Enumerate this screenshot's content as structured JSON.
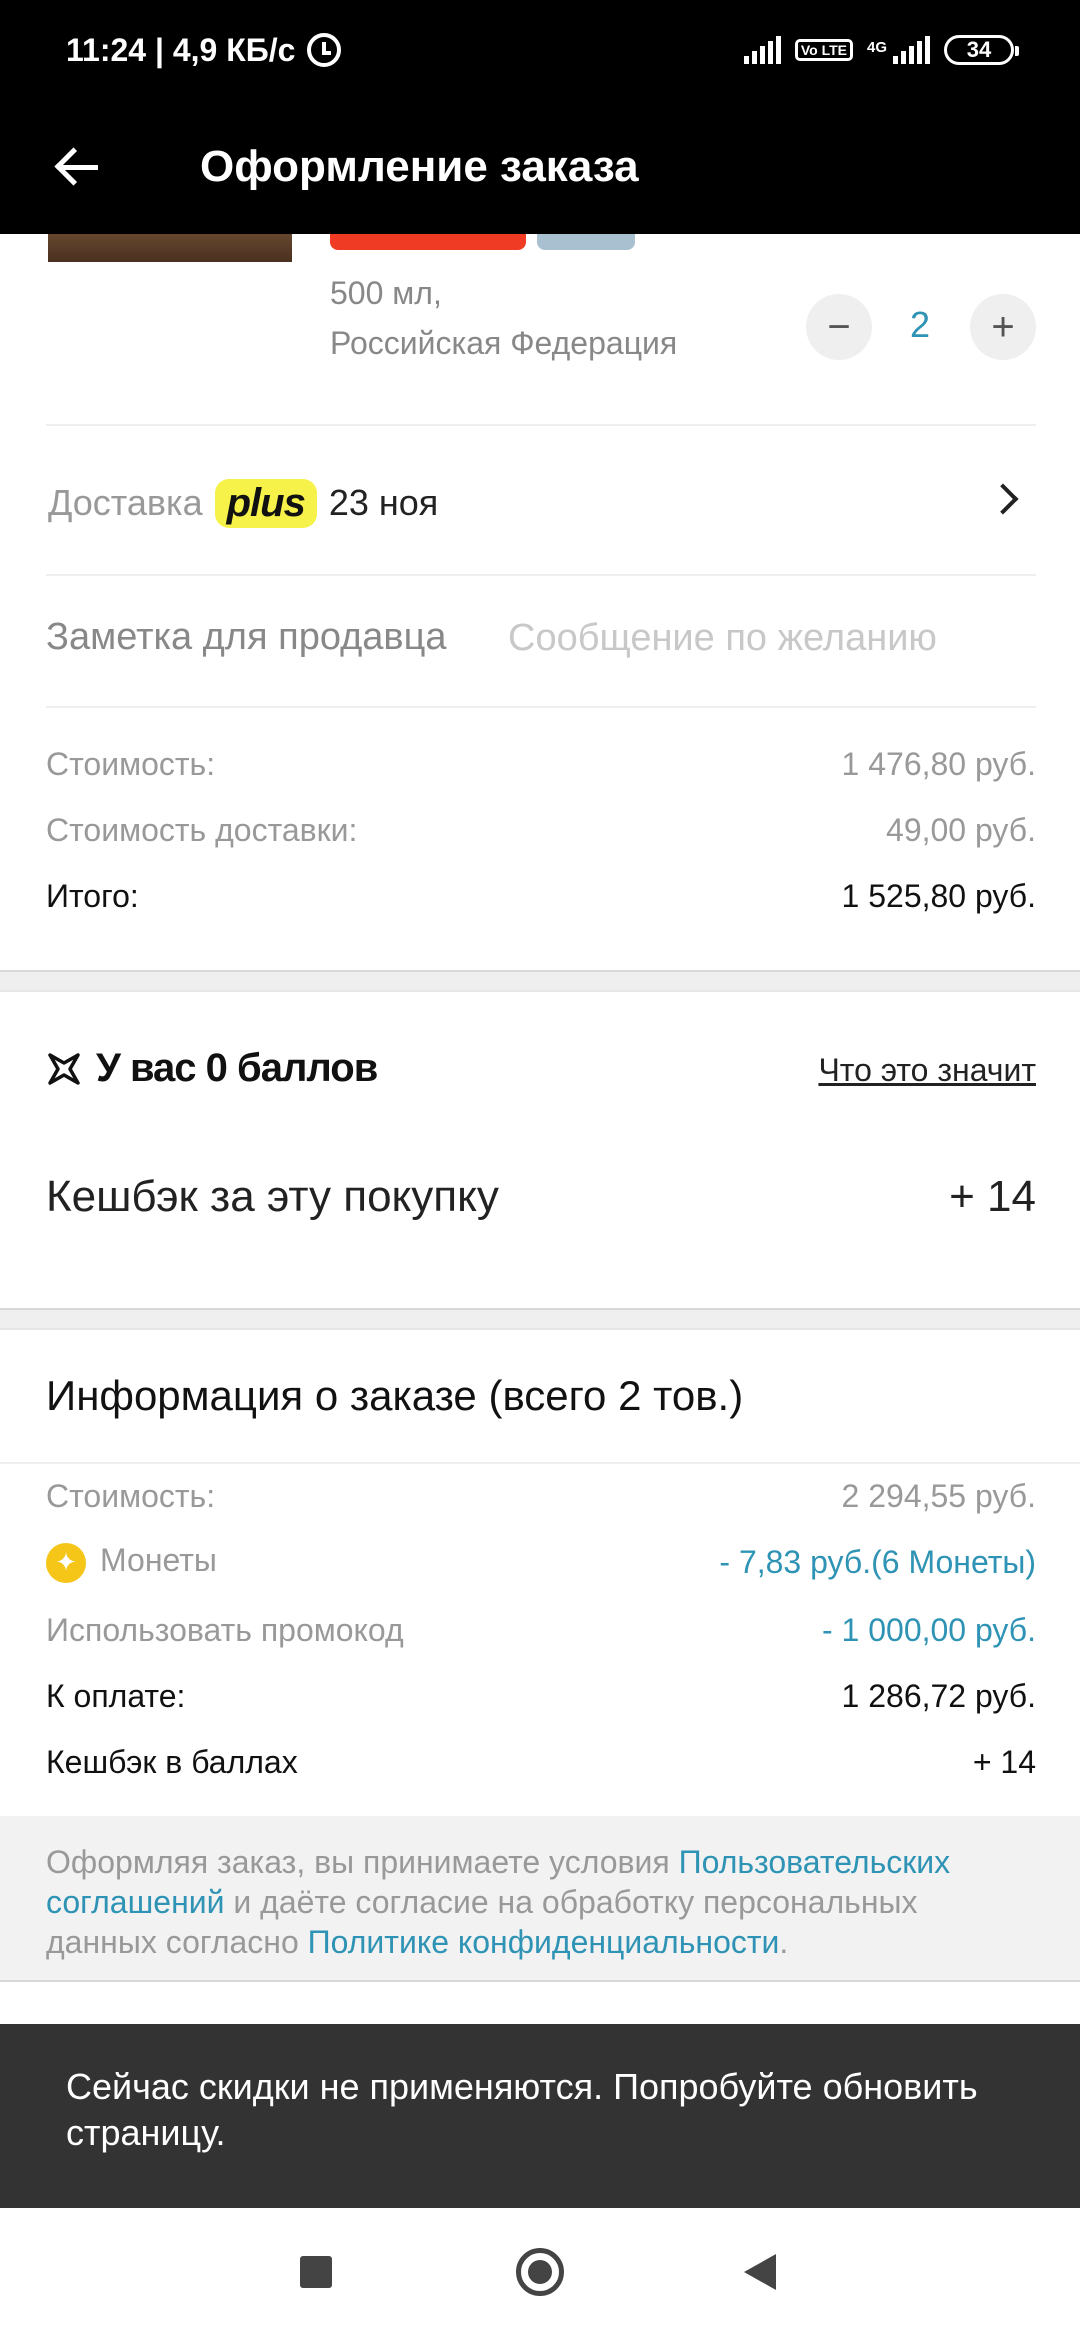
{
  "status_bar": {
    "time_speed": "11:24 | 4,9 КБ/с",
    "volte": "Vo LTE",
    "net": "4G",
    "battery": "34"
  },
  "header": {
    "title": "Оформление заказа"
  },
  "product": {
    "volume": "500 мл,",
    "origin": "Российская Федерация",
    "quantity": "2",
    "minus": "−",
    "plus": "+"
  },
  "delivery": {
    "label": "Доставка",
    "badge": "plus",
    "date": "23 ноя"
  },
  "seller_note": {
    "label": "Заметка для продавца",
    "placeholder": "Сообщение по желанию"
  },
  "summary": {
    "cost_label": "Стоимость:",
    "cost_value": "1 476,80 руб.",
    "shipping_label": "Стоимость доставки:",
    "shipping_value": "49,00 руб.",
    "total_label": "Итого:",
    "total_value": "1 525,80 руб."
  },
  "points": {
    "title": "У вас 0 баллов",
    "link": "Что это значит",
    "cashback_label": "Кешбэк за эту покупку",
    "cashback_value": "+ 14"
  },
  "order_info": {
    "title": "Информация о заказе (всего 2 тов.)",
    "cost_label": "Стоимость:",
    "cost_value": "2 294,55 руб.",
    "coins_label": "Монеты",
    "coins_value": "- 7,83 руб.(6 Монеты)",
    "promo_label": "Использовать промокод",
    "promo_value": "- 1 000,00 руб.",
    "pay_label": "К оплате:",
    "pay_value": "1 286,72 руб.",
    "cashback_label": "Кешбэк в баллах",
    "cashback_value": "+ 14"
  },
  "terms": {
    "part1": "Оформляя заказ, вы принимаете условия ",
    "link1": "Пользовательских соглашений",
    "part2": " и даёте согласие на обработку персональных данных согласно ",
    "link2": "Политике конфиденциальности",
    "part3": "."
  },
  "toast": {
    "message": "Сейчас скидки не применяются. Попробуйте обновить страницу."
  },
  "colors": {
    "accent_blue": "#2e93b4",
    "plus_yellow": "#f6f24a",
    "tag_red": "#ef3b24",
    "coin": "#f5c518"
  },
  "icons": [
    "back-arrow-icon",
    "alarm-icon",
    "chevron-right-icon",
    "points-star-icon",
    "coin-icon",
    "nav-recents-icon",
    "nav-home-icon",
    "nav-back-icon"
  ]
}
